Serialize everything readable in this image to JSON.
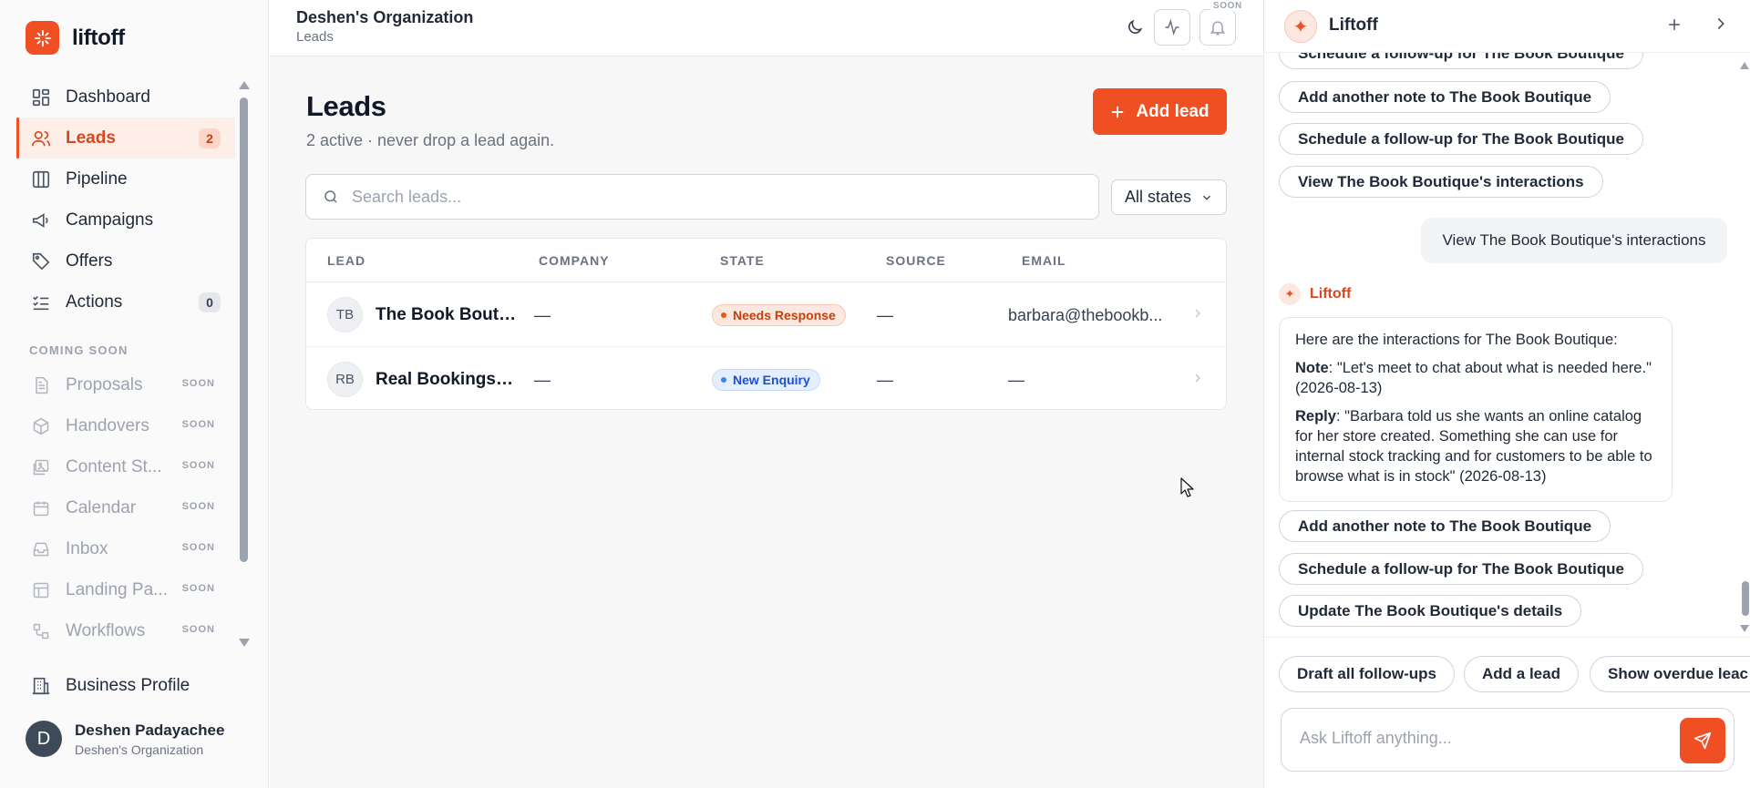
{
  "app": {
    "name": "liftoff"
  },
  "sidebar": {
    "items": [
      {
        "label": "Dashboard",
        "icon": "dashboard-icon"
      },
      {
        "label": "Leads",
        "icon": "users-icon",
        "badge": "2",
        "active": true
      },
      {
        "label": "Pipeline",
        "icon": "pipeline-icon"
      },
      {
        "label": "Campaigns",
        "icon": "megaphone-icon"
      },
      {
        "label": "Offers",
        "icon": "tag-icon"
      },
      {
        "label": "Actions",
        "icon": "checklist-icon",
        "badge": "0"
      }
    ],
    "coming_soon_label": "COMING SOON",
    "soon_tag": "SOON",
    "soon_items": [
      {
        "label": "Proposals",
        "icon": "document-icon"
      },
      {
        "label": "Handovers",
        "icon": "box-icon"
      },
      {
        "label": "Content St...",
        "icon": "image-icon"
      },
      {
        "label": "Calendar",
        "icon": "calendar-icon"
      },
      {
        "label": "Inbox",
        "icon": "inbox-icon"
      },
      {
        "label": "Landing Pa...",
        "icon": "layout-icon"
      },
      {
        "label": "Workflows",
        "icon": "workflow-icon"
      }
    ],
    "business_profile": "Business Profile",
    "user": {
      "initial": "D",
      "name": "Deshen Padayachee",
      "org": "Deshen's Organization"
    }
  },
  "header": {
    "org": "Deshen's Organization",
    "breadcrumb": "Leads",
    "soon_tag": "SOON",
    "icons": [
      "moon-icon",
      "activity-icon",
      "bell-icon"
    ]
  },
  "main": {
    "title": "Leads",
    "subtitle": "2 active · never drop a lead again.",
    "add_button": "Add lead",
    "search_placeholder": "Search leads...",
    "state_filter": "All states",
    "table": {
      "columns": [
        "LEAD",
        "COMPANY",
        "STATE",
        "SOURCE",
        "EMAIL"
      ],
      "rows": [
        {
          "initials": "TB",
          "name": "The Book Boutique",
          "company": "—",
          "state": "Needs Response",
          "state_color": "#ea580c",
          "source": "—",
          "email": "barbara@thebookb..."
        },
        {
          "initials": "RB",
          "name": "Real Bookings B...",
          "company": "—",
          "state": "New Enquiry",
          "state_color": "#3b82f6",
          "source": "—",
          "email": "—"
        }
      ]
    }
  },
  "chat": {
    "title": "Liftoff",
    "chips_top": [
      "Add another note to The Book Boutique",
      "Schedule a follow-up for The Book Boutique",
      "View The Book Boutique's interactions"
    ],
    "user_message": "View The Book Boutique's interactions",
    "bot_name": "Liftoff",
    "bot_intro": "Here are the interactions for The Book Boutique:",
    "note_label": "Note",
    "note_text": ": \"Let's meet to chat about what is needed here.\" (2026-08-13)",
    "reply_label": "Reply",
    "reply_text": ": \"Barbara told us she wants an online catalog for her store created. Something she can use for internal stock tracking and for customers to be able to browse what is in stock\" (2026-08-13)",
    "chips_bottom": [
      "Add another note to The Book Boutique",
      "Schedule a follow-up for The Book Boutique",
      "Update The Book Boutique's details"
    ],
    "suggestions": [
      "Draft all follow-ups",
      "Add a lead",
      "Show overdue leac"
    ],
    "input_placeholder": "Ask Liftoff anything...",
    "accent": "#f04e23"
  }
}
